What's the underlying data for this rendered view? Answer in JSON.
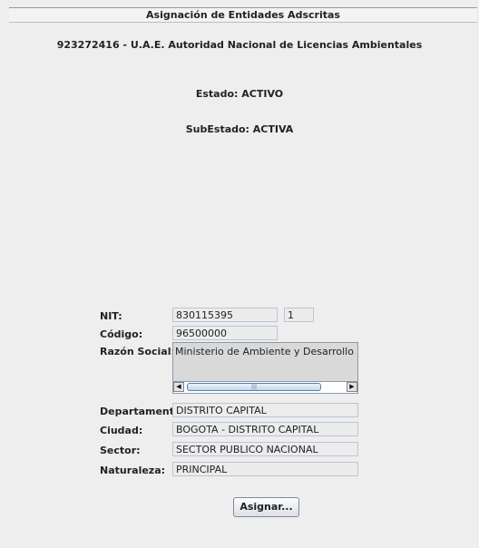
{
  "window": {
    "title": "Asignación de Entidades Adscritas"
  },
  "entity": {
    "title": "923272416 - U.A.E. Autoridad Nacional de Licencias Ambientales"
  },
  "status": {
    "estado": "Estado: ACTIVO",
    "subestado": "SubEstado: ACTIVA"
  },
  "form": {
    "nit": {
      "label": "NIT:",
      "value": "830115395",
      "dv": "1"
    },
    "codigo": {
      "label": "Código:",
      "value": "96500000"
    },
    "razon_social": {
      "label": "Razón Social:",
      "value": "Ministerio de Ambiente y Desarrollo Sostenible"
    },
    "departamento": {
      "label": "Departamento:",
      "value": "DISTRITO CAPITAL"
    },
    "ciudad": {
      "label": "Ciudad:",
      "value": "BOGOTA - DISTRITO CAPITAL"
    },
    "sector": {
      "label": "Sector:",
      "value": "SECTOR PUBLICO NACIONAL"
    },
    "naturaleza": {
      "label": "Naturaleza:",
      "value": "PRINCIPAL"
    }
  },
  "scrollbar": {
    "left_arrow": "◀",
    "right_arrow": "▶",
    "grip": "|||"
  },
  "actions": {
    "assign_label": "Asignar..."
  }
}
